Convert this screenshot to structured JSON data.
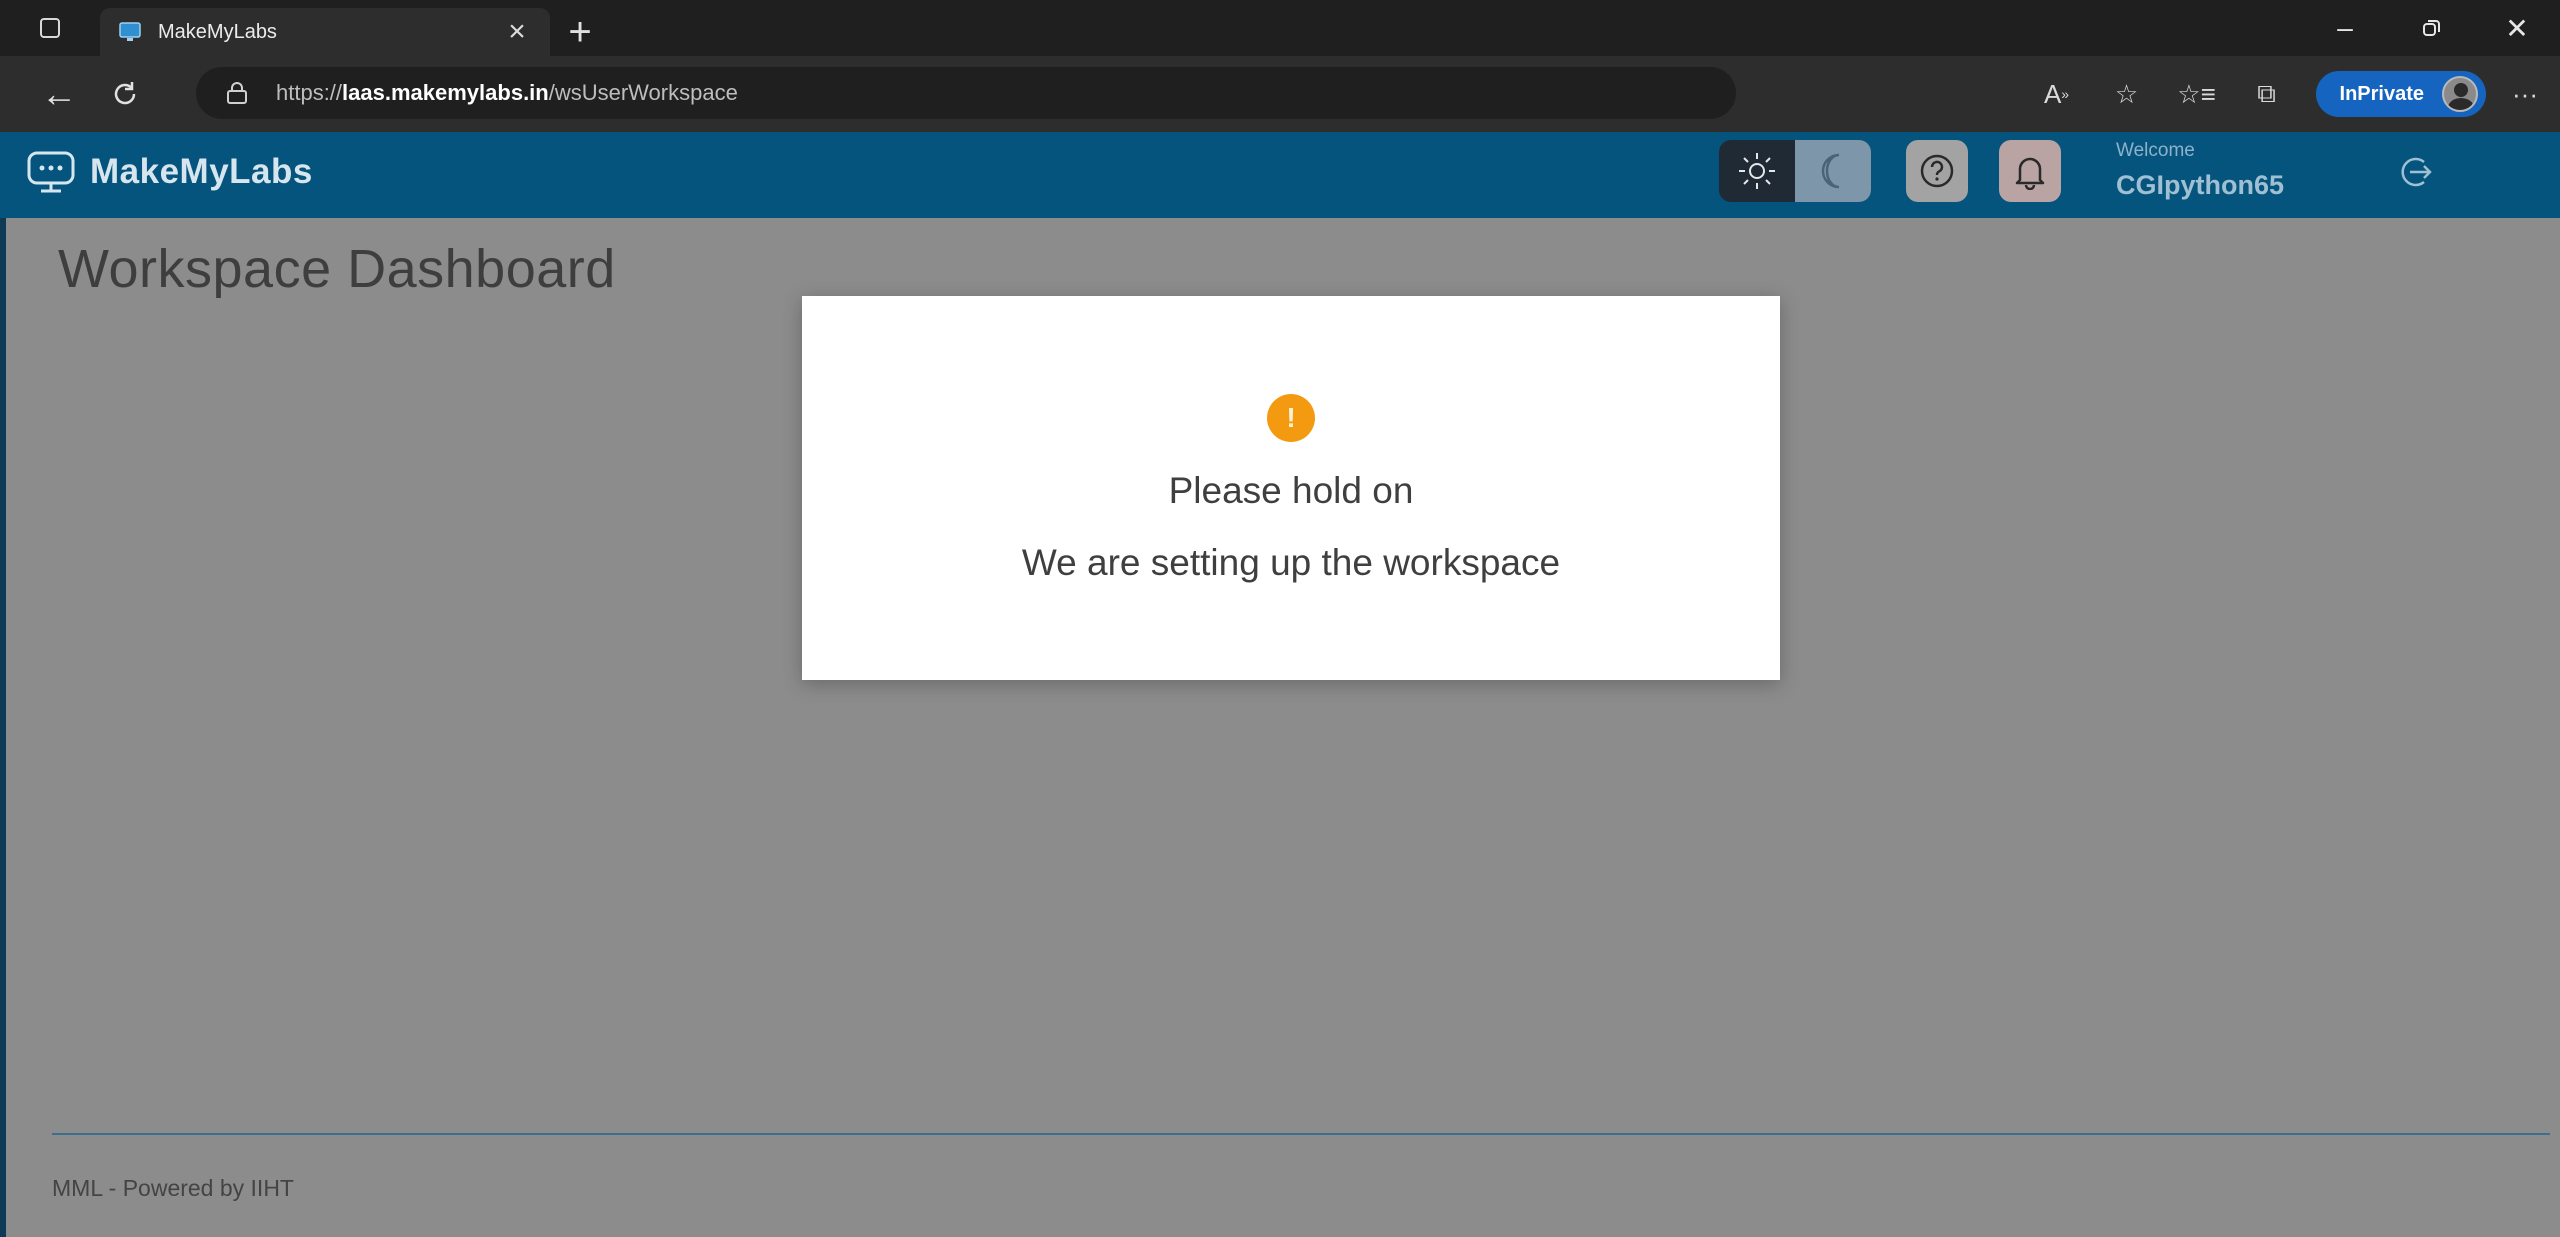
{
  "browser": {
    "tab_title": "MakeMyLabs",
    "url_scheme": "https://",
    "url_host": "laas.makemylabs.in",
    "url_path": "/wsUserWorkspace",
    "inprivate_label": "InPrivate"
  },
  "header": {
    "brand": "MakeMyLabs",
    "welcome_label": "Welcome",
    "username": "CGIpython65"
  },
  "page": {
    "title": "Workspace Dashboard",
    "footer": "MML - Powered by IIHT"
  },
  "modal": {
    "icon_glyph": "!",
    "line1": "Please hold on",
    "line2": "We are setting up the workspace"
  },
  "colors": {
    "header_bg": "#04547d",
    "overlay_bg": "#8c8c8c",
    "warning": "#f39a10",
    "inprivate": "#1565c0"
  }
}
